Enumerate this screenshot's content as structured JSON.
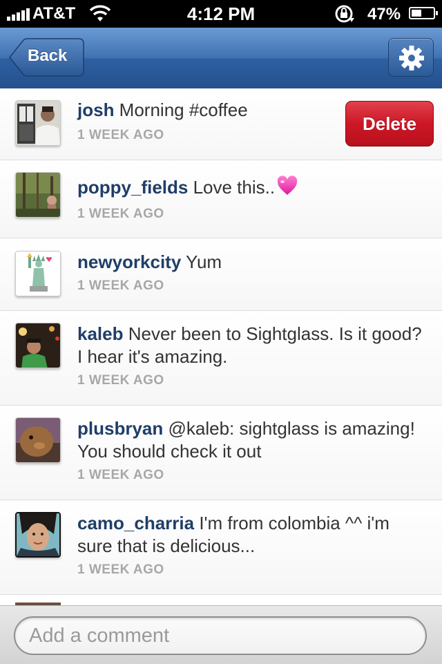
{
  "status_bar": {
    "carrier": "AT&T",
    "time": "4:12 PM",
    "battery": "47%",
    "battery_level": 0.47
  },
  "nav": {
    "back_label": "Back",
    "settings_icon": "gear-icon"
  },
  "comments": [
    {
      "username": "josh",
      "text": " Morning #coffee",
      "time": "1 WEEK AGO",
      "delete_label": "Delete"
    },
    {
      "username": "poppy_fields",
      "text": " Love this..",
      "emoji": "pink-heart-icon",
      "time": "1 WEEK AGO"
    },
    {
      "username": "newyorkcity",
      "text": " Yum",
      "time": "1 WEEK AGO"
    },
    {
      "username": "kaleb",
      "text": " Never been to Sightglass. Is it good? I hear it's amazing.",
      "time": "1 WEEK AGO"
    },
    {
      "username": "plusbryan",
      "text": " @kaleb: sightglass is amazing! You should check it out",
      "time": "1 WEEK AGO"
    },
    {
      "username": "camo_charria",
      "text": " I'm from colombia ^^ i'm sure that is delicious...",
      "time": "1 WEEK AGO"
    }
  ],
  "comment_input": {
    "placeholder": "Add a comment"
  }
}
